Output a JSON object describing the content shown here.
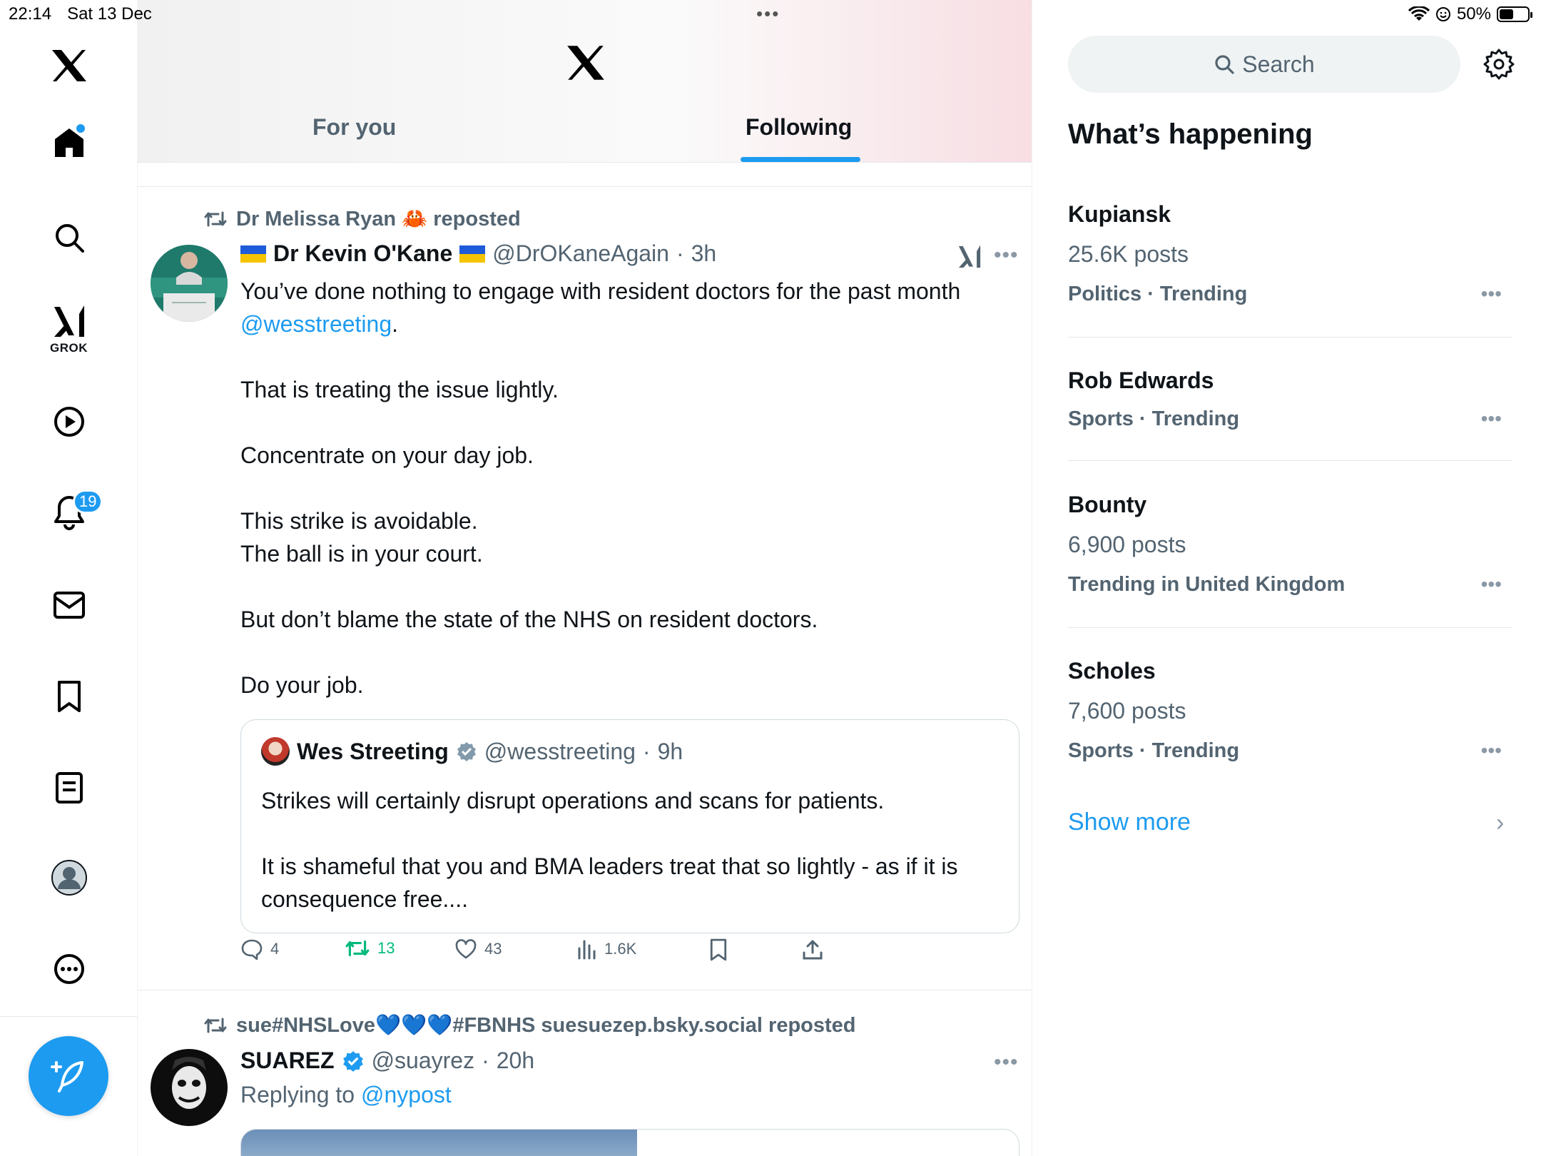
{
  "status_bar": {
    "time": "22:14",
    "date": "Sat 13 Dec",
    "battery": "50%"
  },
  "nav": {
    "grok_label": "GROK",
    "notifications_count": "19"
  },
  "header": {
    "tabs": [
      {
        "label": "For you"
      },
      {
        "label": "Following"
      }
    ],
    "active_tab": "Following"
  },
  "posts": [
    {
      "reposted_by": "Dr Melissa Ryan 🦀 reposted",
      "author_name": "Dr Kevin O'Kane",
      "handle": "@DrOKaneAgain",
      "time": "3h",
      "paragraphs": [
        {
          "before": "You’ve done nothing to engage with resident doctors for the past month ",
          "mention": "@wesstreeting",
          "after": "."
        },
        {
          "text": "That is treating the issue lightly."
        },
        {
          "text": "Concentrate on your day job."
        },
        {
          "line1": "This strike is avoidable.",
          "line2": "The ball is in your court."
        },
        {
          "text": "But don’t blame the state of the NHS on resident doctors."
        },
        {
          "text": "Do your job."
        }
      ],
      "quote": {
        "author_name": "Wes Streeting",
        "handle": "@wesstreeting",
        "time": "9h",
        "paragraph1": "Strikes will certainly disrupt operations and scans for patients.",
        "paragraph2": "It is shameful that you and BMA leaders treat that so lightly - as if it is consequence free...."
      },
      "stats": {
        "replies": "4",
        "reposts": "13",
        "likes": "43",
        "views": "1.6K"
      }
    },
    {
      "reposted_by": "sue#NHSLove💙💙💙#FBNHS suesuezep.bsky.social reposted",
      "author_name": "SUAREZ",
      "handle": "@suayrez",
      "time": "20h",
      "replying_label": "Replying to",
      "replying_to": "@nypost"
    }
  ],
  "sidebar": {
    "search_placeholder": "Search",
    "title": "What’s happening",
    "trends": [
      {
        "name": "Kupiansk",
        "posts": "25.6K posts",
        "category": "Politics · Trending"
      },
      {
        "name": "Rob Edwards",
        "posts": "",
        "category": "Sports · Trending"
      },
      {
        "name": "Bounty",
        "posts": "6,900 posts",
        "category": "Trending in United Kingdom"
      },
      {
        "name": "Scholes",
        "posts": "7,600 posts",
        "category": "Sports · Trending"
      }
    ],
    "show_more": "Show more"
  },
  "colors": {
    "accent": "#1d9bf0",
    "repost_green": "#00ba7c",
    "secondary_text": "#536471"
  }
}
